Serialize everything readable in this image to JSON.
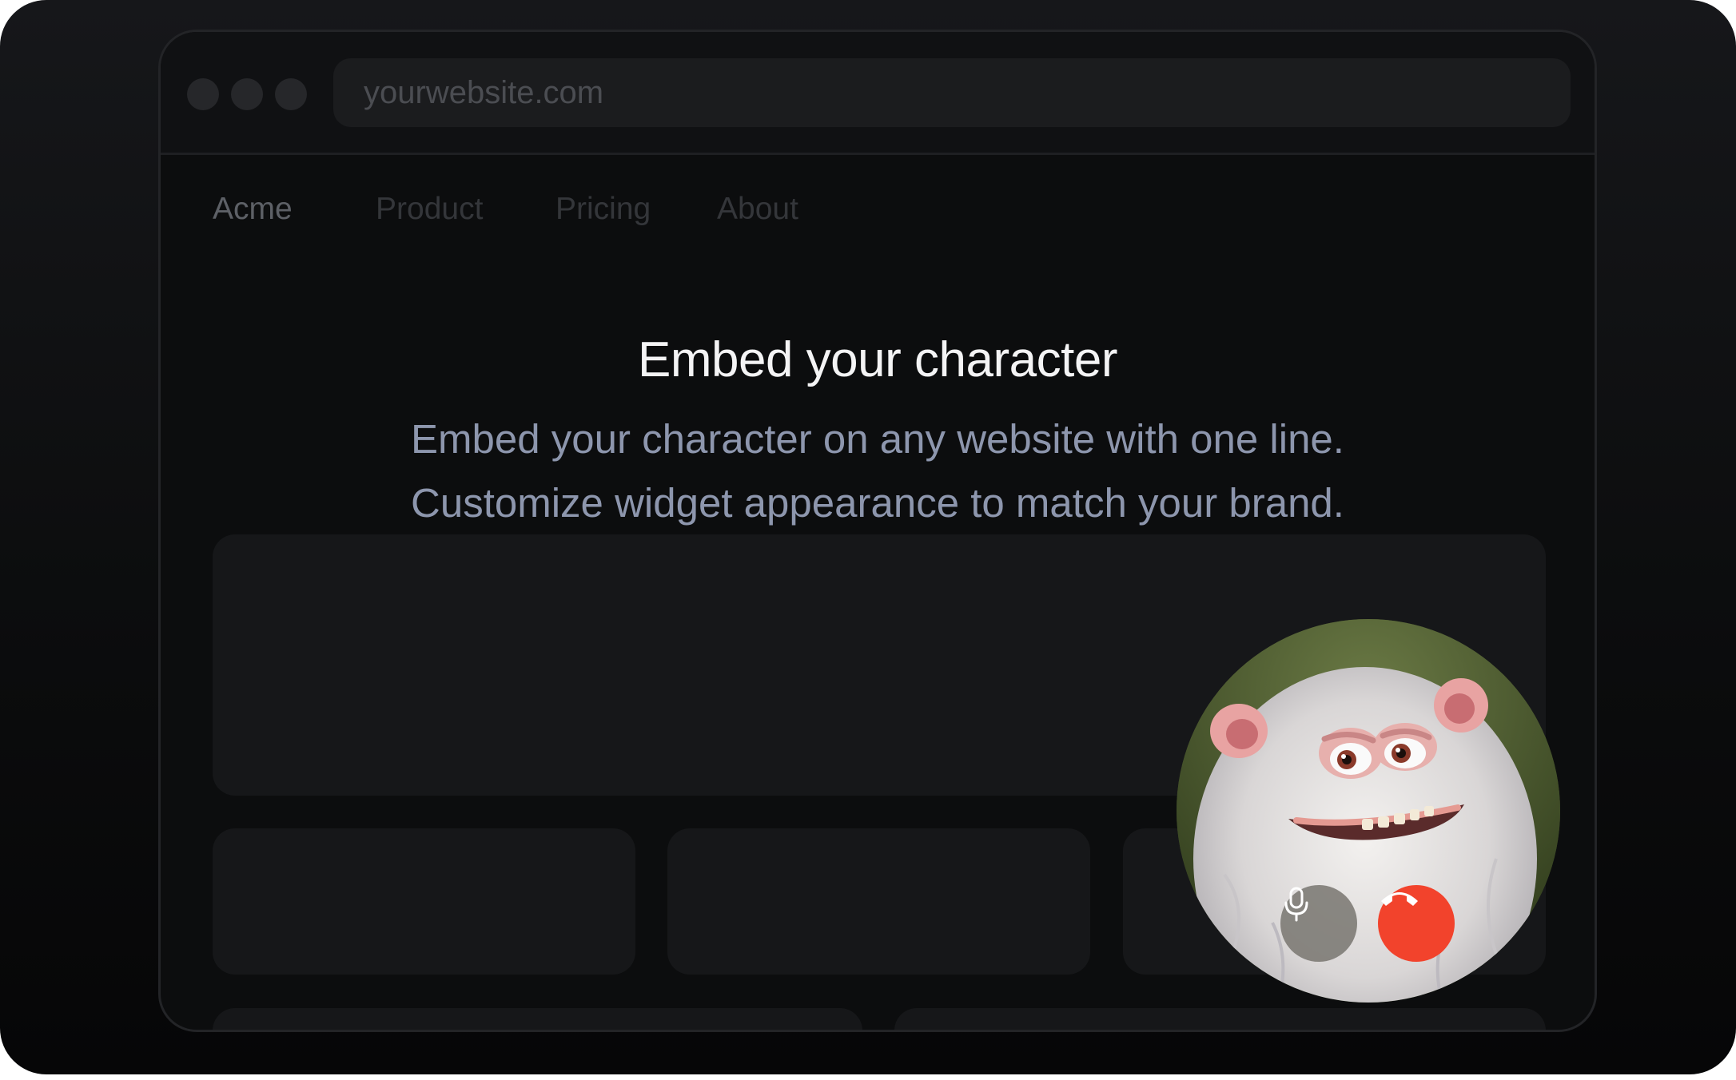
{
  "browser": {
    "url": "yourwebsite.com"
  },
  "nav": {
    "brand": "Acme",
    "links": [
      "Product",
      "Pricing",
      "About"
    ]
  },
  "hero": {
    "title": "Embed your character",
    "subtitle_line1": "Embed your character on any website with one line.",
    "subtitle_line2": "Customize widget appearance to match your brand."
  },
  "widget": {
    "controls": [
      {
        "icon": "microphone-icon"
      },
      {
        "icon": "end-call-icon",
        "color": "#f2432c"
      }
    ]
  },
  "colors": {
    "end_call": "#f2432c",
    "background": "#0c0d0e"
  }
}
